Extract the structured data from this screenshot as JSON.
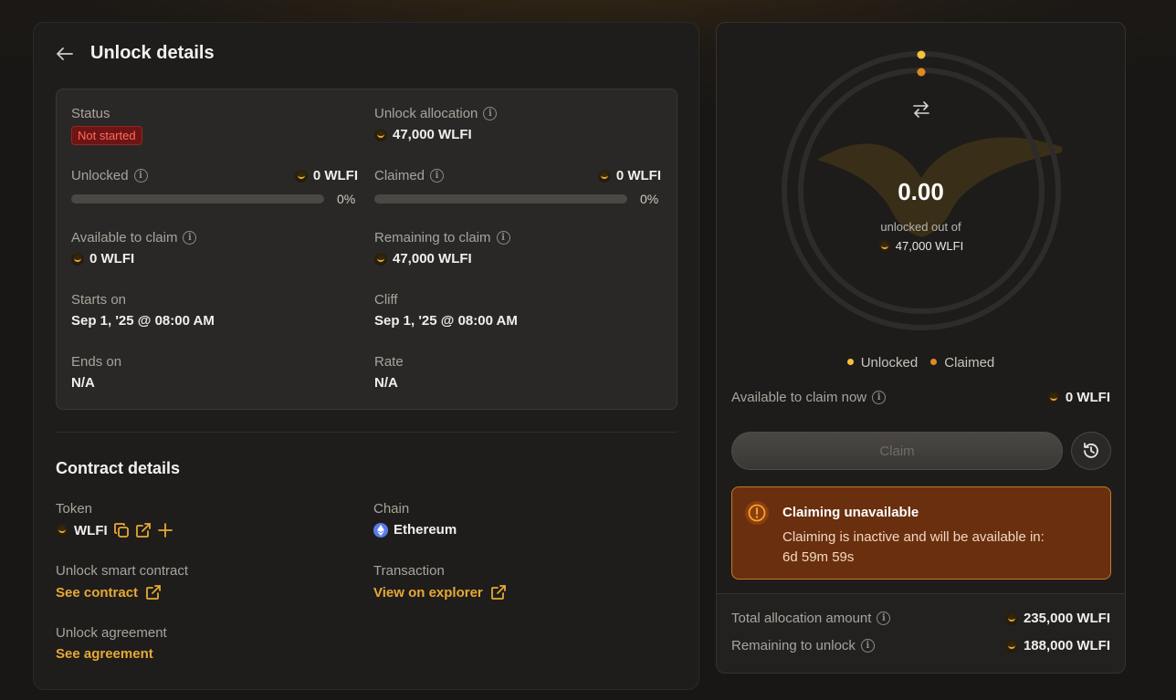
{
  "header": {
    "title": "Unlock details"
  },
  "info": {
    "status_label": "Status",
    "status_value": "Not started",
    "allocation_label": "Unlock allocation",
    "allocation_value": "47,000 WLFI",
    "unlocked_label": "Unlocked",
    "unlocked_value": "0 WLFI",
    "unlocked_pct": "0%",
    "unlocked_fraction": 0,
    "claimed_label": "Claimed",
    "claimed_value": "0 WLFI",
    "claimed_pct": "0%",
    "claimed_fraction": 0,
    "available_label": "Available to claim",
    "available_value": "0 WLFI",
    "remaining_label": "Remaining to claim",
    "remaining_value": "47,000 WLFI",
    "starts_label": "Starts on",
    "starts_value": "Sep 1, '25 @ 08:00 AM",
    "cliff_label": "Cliff",
    "cliff_value": "Sep 1, '25 @ 08:00 AM",
    "ends_label": "Ends on",
    "ends_value": "N/A",
    "rate_label": "Rate",
    "rate_value": "N/A"
  },
  "contract": {
    "title": "Contract details",
    "token_label": "Token",
    "token_value": "WLFI",
    "chain_label": "Chain",
    "chain_value": "Ethereum",
    "smart_contract_label": "Unlock smart contract",
    "smart_contract_link": "See contract",
    "transaction_label": "Transaction",
    "transaction_link": "View on explorer",
    "agreement_label": "Unlock agreement",
    "agreement_link": "See agreement"
  },
  "summary": {
    "amount": "0.00",
    "unlocked_out_of": "unlocked out of",
    "total": "47,000 WLFI",
    "legend_unlocked": "Unlocked",
    "legend_claimed": "Claimed",
    "available_now_label": "Available to claim now",
    "available_now_value": "0 WLFI",
    "claim_button": "Claim",
    "warning_title": "Claiming unavailable",
    "warning_text": "Claiming is inactive and will be available in:",
    "warning_countdown": "6d 59m 59s",
    "total_alloc_label": "Total allocation amount",
    "total_alloc_value": "235,000 WLFI",
    "remaining_unlock_label": "Remaining to unlock",
    "remaining_unlock_value": "188,000 WLFI"
  },
  "colors": {
    "accent": "#e6a935",
    "unlocked_dot": "#f5c13a",
    "claimed_dot": "#e08a1e",
    "badge_bg": "#6e1414",
    "warning_bg": "#6a2f0e"
  },
  "icons": [
    "back-arrow-icon",
    "info-icon",
    "token-icon",
    "copy-icon",
    "external-link-icon",
    "plus-icon",
    "ethereum-icon",
    "swap-icon",
    "history-icon",
    "warning-icon"
  ]
}
